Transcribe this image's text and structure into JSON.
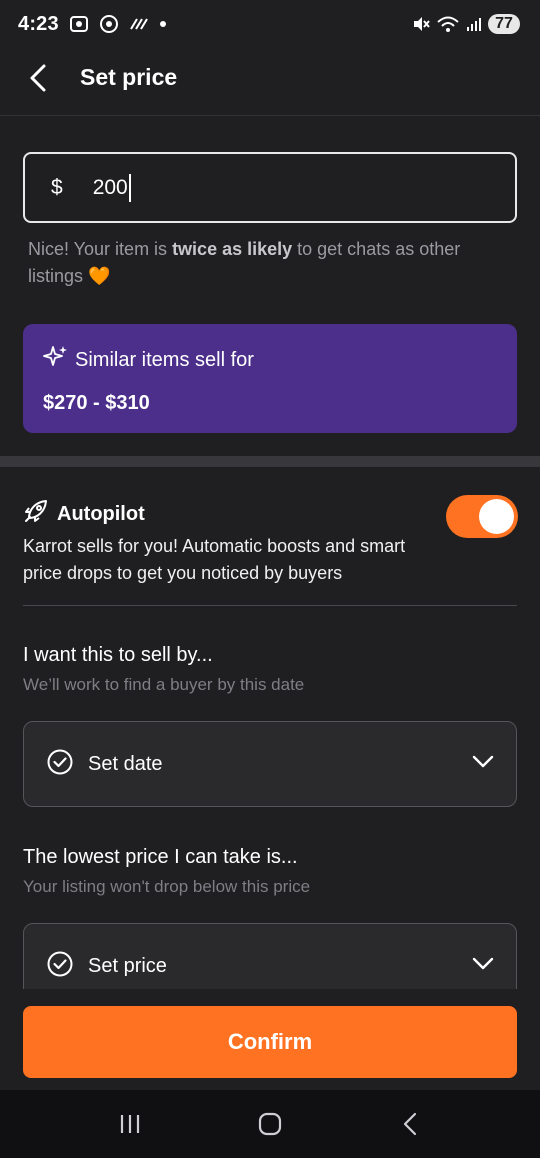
{
  "status_bar": {
    "time": "4:23",
    "battery": "77",
    "icons": [
      "screenshot-icon",
      "chrome-icon",
      "signal-activity-icon",
      "dot-icon",
      "mute-icon",
      "wifi-6e-icon",
      "cell-signal-icon"
    ]
  },
  "app_bar": {
    "title": "Set price",
    "back_icon": "chevron-left-icon"
  },
  "price_input": {
    "currency": "$",
    "value": "200"
  },
  "helper": {
    "prefix": "Nice! Your item is ",
    "emphasis": "twice as likely",
    "suffix": " to get chats as other listings",
    "emoji": "🧡"
  },
  "similar": {
    "label": "Similar items sell for",
    "range": "$270 - $310",
    "icon": "sparkle-icon"
  },
  "autopilot": {
    "title": "Autopilot",
    "icon": "rocket-icon",
    "description": "Karrot sells for you! Automatic boosts and smart price drops to get you noticed by buyers",
    "enabled": true
  },
  "sell_by": {
    "title": "I want this to sell by...",
    "subtitle": "We’ll work to find a buyer by this date",
    "select_label": "Set date"
  },
  "lowest_price": {
    "title": "The lowest price I can take is...",
    "subtitle": "Your listing won't drop below this price",
    "select_label": "Set price"
  },
  "confirm": {
    "label": "Confirm"
  },
  "colors": {
    "background": "#1f1f21",
    "accent": "#ff7222",
    "purple_card": "#4b2f8a"
  }
}
